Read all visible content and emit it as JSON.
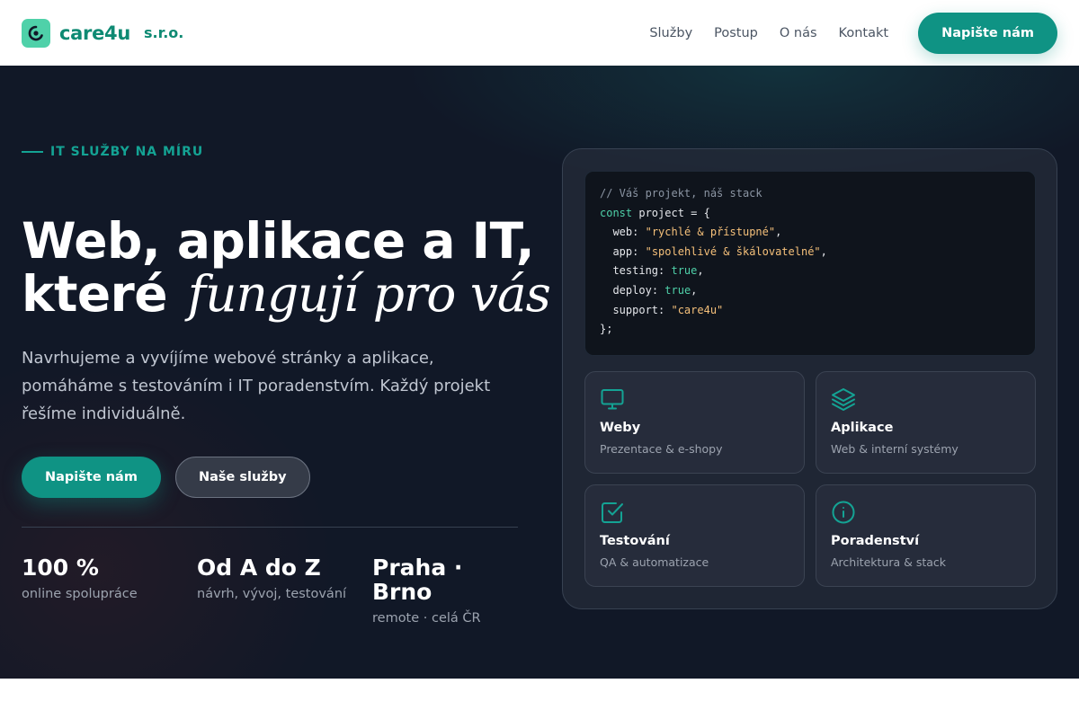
{
  "brand": {
    "name": "care4u",
    "suffix": "s.r.o.",
    "accent_color": "#0f9384"
  },
  "nav": {
    "items": [
      {
        "label": "Služby"
      },
      {
        "label": "Postup"
      },
      {
        "label": "O nás"
      },
      {
        "label": "Kontakt"
      }
    ],
    "cta_label": "Napište nám"
  },
  "hero": {
    "eyebrow": "IT SLUŽBY NA MÍRU",
    "title_line1": "Web, aplikace a IT,",
    "title_line2_plain": "které",
    "title_line2_accent": "fungují pro vás",
    "description": "Navrhujeme a vyvíjíme webové stránky a aplikace, pomáháme s testováním i IT poradenstvím. Každý projekt řešíme individuálně.",
    "primary_button": "Napište nám",
    "secondary_button": "Naše služby",
    "stats": [
      {
        "value": "100 %",
        "label": "online spolupráce"
      },
      {
        "value": "Od A do Z",
        "label": "návrh, vývoj, testování"
      },
      {
        "value": "Praha · Brno",
        "label": "remote · celá ČR"
      }
    ]
  },
  "code": {
    "comment": "// Váš projekt, náš stack",
    "keyword": "const",
    "declaration": " project = {",
    "fields": [
      {
        "key": "web",
        "value": "\"rychlé & přístupné\"",
        "kind": "string"
      },
      {
        "key": "app",
        "value": "\"spolehlivé & škálovatelné\"",
        "kind": "string"
      },
      {
        "key": "testing",
        "value": "true",
        "kind": "bool"
      },
      {
        "key": "deploy",
        "value": "true",
        "kind": "bool"
      },
      {
        "key": "support",
        "value": "\"care4u\"",
        "kind": "string"
      }
    ],
    "closing": "};"
  },
  "services": [
    {
      "title": "Weby",
      "subtitle": "Prezentace & e-shopy",
      "icon": "monitor-icon"
    },
    {
      "title": "Aplikace",
      "subtitle": "Web & interní systémy",
      "icon": "layers-icon"
    },
    {
      "title": "Testování",
      "subtitle": "QA & automatizace",
      "icon": "check-square-icon"
    },
    {
      "title": "Poradenství",
      "subtitle": "Architektura & stack",
      "icon": "info-circle-icon"
    }
  ]
}
